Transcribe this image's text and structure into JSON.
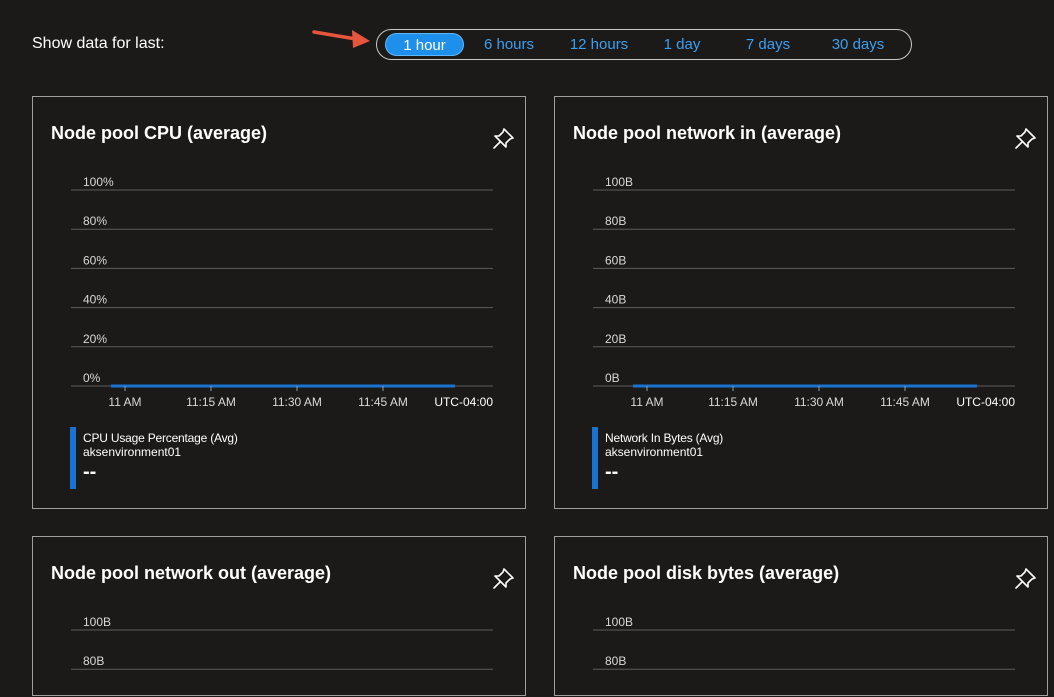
{
  "toolbar": {
    "label": "Show data for last:",
    "ranges": [
      "1 hour",
      "6 hours",
      "12 hours",
      "1 day",
      "7 days",
      "30 days"
    ],
    "selected": "1 hour"
  },
  "colors": {
    "accent": "#1e8fea",
    "series": "#1a73d0",
    "arrow": "#e8553d",
    "background": "#1b1a19"
  },
  "icons": {
    "pin": "pin-icon",
    "arrow": "red-arrow-icon"
  },
  "cards": [
    {
      "title": "Node pool CPU (average)",
      "legend": {
        "metric": "CPU Usage Percentage (Avg)",
        "resource": "aksenvironment01",
        "value": "--"
      },
      "chart_data": {
        "type": "line",
        "y_ticks": [
          "100%",
          "80%",
          "60%",
          "40%",
          "20%",
          "0%"
        ],
        "x_ticks": [
          "11 AM",
          "11:15 AM",
          "11:30 AM",
          "11:45 AM"
        ],
        "timezone": "UTC-04:00",
        "ylim": [
          0,
          100
        ],
        "series": [
          {
            "name": "CPU Usage Percentage (Avg)",
            "values": [
              0,
              0,
              0,
              0,
              0
            ]
          }
        ]
      }
    },
    {
      "title": "Node pool network in (average)",
      "legend": {
        "metric": "Network In Bytes (Avg)",
        "resource": "aksenvironment01",
        "value": "--"
      },
      "chart_data": {
        "type": "line",
        "y_ticks": [
          "100B",
          "80B",
          "60B",
          "40B",
          "20B",
          "0B"
        ],
        "x_ticks": [
          "11 AM",
          "11:15 AM",
          "11:30 AM",
          "11:45 AM"
        ],
        "timezone": "UTC-04:00",
        "ylim": [
          0,
          100
        ],
        "series": [
          {
            "name": "Network In Bytes (Avg)",
            "values": [
              0,
              0,
              0,
              0,
              0
            ]
          }
        ]
      }
    },
    {
      "title": "Node pool network out (average)",
      "chart_data": {
        "type": "line",
        "y_ticks": [
          "100B",
          "80B"
        ],
        "ylim": [
          0,
          100
        ]
      }
    },
    {
      "title": "Node pool disk bytes (average)",
      "chart_data": {
        "type": "line",
        "y_ticks": [
          "100B",
          "80B"
        ],
        "ylim": [
          0,
          100
        ]
      }
    }
  ]
}
